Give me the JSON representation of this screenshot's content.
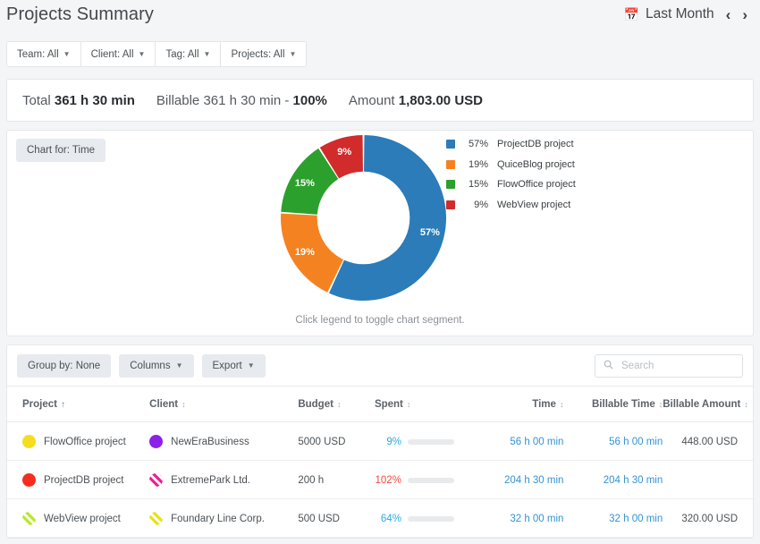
{
  "header": {
    "title": "Projects Summary",
    "date_range": "Last Month",
    "calendar_icon": "calendar-icon",
    "prev_icon": "‹",
    "next_icon": "›"
  },
  "filters": [
    {
      "label": "Team: All",
      "name": "filter-team"
    },
    {
      "label": "Client: All",
      "name": "filter-client"
    },
    {
      "label": "Tag: All",
      "name": "filter-tag"
    },
    {
      "label": "Projects: All",
      "name": "filter-projects"
    }
  ],
  "summary": {
    "total_label": "Total",
    "total_value": "361 h 30 min",
    "billable_label": "Billable",
    "billable_value": "361 h 30 min - ",
    "billable_pct": "100%",
    "amount_label": "Amount",
    "amount_value": "1,803.00 USD"
  },
  "chart_panel": {
    "chart_for_label": "Chart for: Time",
    "hint": "Click legend to toggle chart segment."
  },
  "chart_data": {
    "type": "pie",
    "title": "",
    "subtype": "donut",
    "categories": [
      "ProjectDB project",
      "QuiceBlog project",
      "FlowOffice project",
      "WebView project"
    ],
    "values": [
      57,
      19,
      15,
      9
    ],
    "value_labels": [
      "57%",
      "19%",
      "15%",
      "9%"
    ],
    "colors": [
      "#2b7cb8",
      "#f58220",
      "#2ca02c",
      "#d22b2b"
    ],
    "legend_position": "right",
    "legend": [
      {
        "pct": "57%",
        "name": "ProjectDB project",
        "color": "#2b7cb8"
      },
      {
        "pct": "19%",
        "name": "QuiceBlog project",
        "color": "#f58220"
      },
      {
        "pct": "15%",
        "name": "FlowOffice project",
        "color": "#2ca02c"
      },
      {
        "pct": "9%",
        "name": "WebView project",
        "color": "#d22b2b"
      }
    ],
    "start_angle_deg": 0,
    "direction": "clockwise",
    "inner_radius_ratio": 0.56
  },
  "table_toolbar": {
    "group_by": "Group by: None",
    "columns": "Columns",
    "export": "Export",
    "search_placeholder": "Search",
    "search_value": "",
    "search_icon": "search-icon"
  },
  "table": {
    "columns": [
      {
        "label": "Project",
        "sort": "asc"
      },
      {
        "label": "Client",
        "sort": "none"
      },
      {
        "label": "Budget",
        "sort": "none"
      },
      {
        "label": "Spent",
        "sort": "none"
      },
      {
        "label": "Time",
        "sort": "none"
      },
      {
        "label": "Billable Time",
        "sort": "none"
      },
      {
        "label": "Billable Amount",
        "sort": "none"
      }
    ],
    "rows": [
      {
        "project": "FlowOffice project",
        "project_color": "#f5dd1e",
        "project_pattern": "solid",
        "client": "NewEraBusiness",
        "client_color": "#8b22e8",
        "client_pattern": "solid",
        "budget": "5000 USD",
        "spent_pct": "9%",
        "spent_value": 9,
        "spent_color": "#29abe2",
        "time": "56 h 00 min",
        "billable_time": "56 h 00 min",
        "billable_amount": "448.00 USD"
      },
      {
        "project": "ProjectDB project",
        "project_color": "#f52d20",
        "project_pattern": "solid",
        "client": "ExtremePark Ltd.",
        "client_color": "#ea1e9a",
        "client_pattern": "striped",
        "budget": "200 h",
        "spent_pct": "102%",
        "spent_value": 100,
        "spent_color": "#f5483c",
        "time": "204 h 30 min",
        "billable_time": "204 h 30 min",
        "billable_amount": ""
      },
      {
        "project": "WebView project",
        "project_color": "#b8e82a",
        "project_pattern": "striped",
        "client": "Foundary Line Corp.",
        "client_color": "#e8e215",
        "client_pattern": "striped",
        "budget": "500 USD",
        "spent_pct": "64%",
        "spent_value": 64,
        "spent_color": "#29abe2",
        "time": "32 h 00 min",
        "billable_time": "32 h 00 min",
        "billable_amount": "320.00 USD"
      }
    ]
  }
}
